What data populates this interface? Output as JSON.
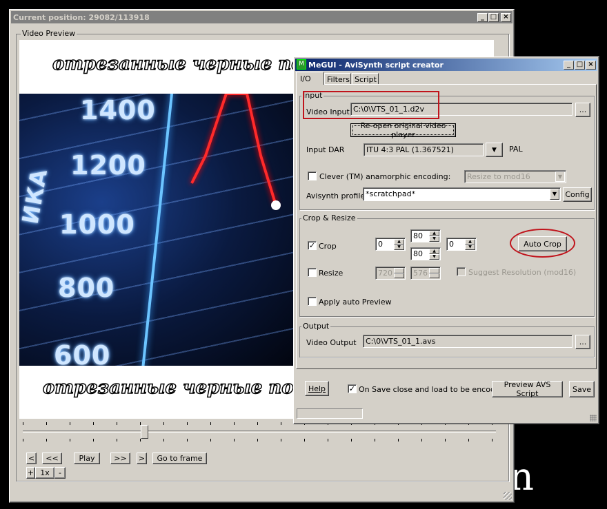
{
  "background_glyph": "n",
  "player": {
    "title": "Current position: 29082/113918",
    "group_label": "Video Preview",
    "caption_top": "отрезанные черные поля",
    "caption_bottom": "отрезанные черные поля",
    "chart_numbers": [
      "1400",
      "1200",
      "1000",
      "800",
      "600"
    ],
    "side_text": "ИКА",
    "slider_position": 0.2553,
    "buttons": {
      "prev": "<",
      "rewind": "<<",
      "play": "Play",
      "forward": ">>",
      "next": ">",
      "goto": "Go to frame",
      "zoom_in": "+",
      "zoom": "1x",
      "zoom_out": "-"
    }
  },
  "dialog": {
    "title": "MeGUI - AviSynth script creator",
    "tabs": [
      {
        "label": "I/O",
        "active": true
      },
      {
        "label": "Filters"
      },
      {
        "label": "Script"
      }
    ],
    "input": {
      "group_label": "Input",
      "video_input_label": "Video Input",
      "video_input_value": "C:\\0\\VTS_01_1.d2v",
      "browse": "...",
      "reopen": "Re-open original video player",
      "dar_label": "Input DAR",
      "dar_value": "ITU 4:3 PAL (1.367521)",
      "dar_suffix": "PAL",
      "clever_label": "Clever (TM) anamorphic encoding:",
      "clever_checked": false,
      "clever_mode": "Resize to mod16",
      "profile_label": "Avisynth profile",
      "profile_value": "*scratchpad*",
      "config": "Config"
    },
    "crop": {
      "group_label": "Crop & Resize",
      "crop_label": "Crop",
      "crop_checked": true,
      "left": "0",
      "top": "80",
      "bottom": "80",
      "right": "0",
      "auto_crop": "Auto Crop",
      "resize_label": "Resize",
      "resize_checked": false,
      "width": "720",
      "height": "576",
      "suggest_label": "Suggest Resolution (mod16)",
      "suggest_checked": false,
      "auto_preview_label": "Apply auto Preview",
      "auto_preview_checked": false
    },
    "output": {
      "group_label": "Output",
      "video_output_label": "Video Output",
      "video_output_value": "C:\\0\\VTS_01_1.avs",
      "browse": "..."
    },
    "footer": {
      "help": "Help",
      "on_save_label": "On Save close and load to be encoded",
      "on_save_checked": true,
      "preview": "Preview AVS Script",
      "save": "Save"
    },
    "highlight_color": "#c0141c"
  }
}
